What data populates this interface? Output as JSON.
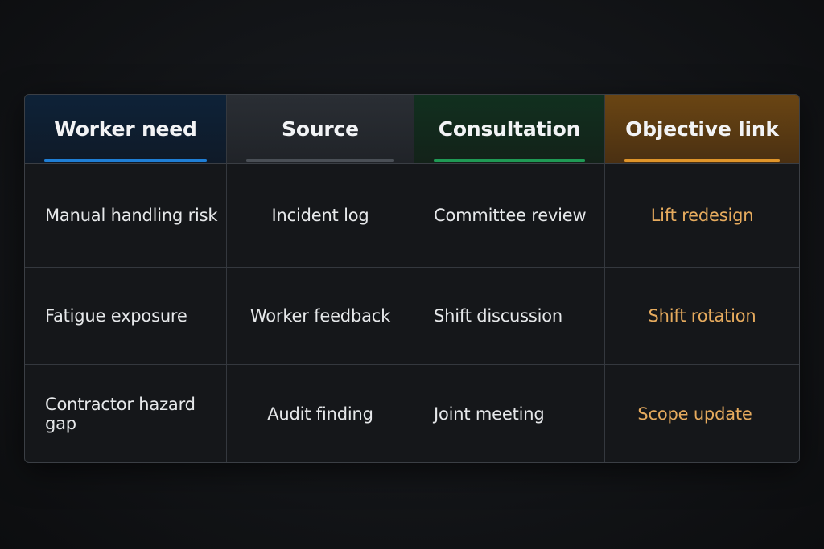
{
  "table": {
    "headers": [
      "Worker need",
      "Source",
      "Consultation",
      "Objective link"
    ],
    "rows": [
      [
        "Manual handling risk",
        "Incident log",
        "Committee review",
        "Lift redesign"
      ],
      [
        "Fatigue exposure",
        "Worker feedback",
        "Shift discussion",
        "Shift rotation"
      ],
      [
        "Contractor hazard gap",
        "Audit finding",
        "Joint meeting",
        "Scope update"
      ]
    ]
  },
  "colors": {
    "worker_need_accent": "#1f7fd6",
    "source_accent": "#4a4f56",
    "consultation_accent": "#1f9a55",
    "objective_link_accent": "#e0952a",
    "objective_text": "#e6ab5e"
  }
}
